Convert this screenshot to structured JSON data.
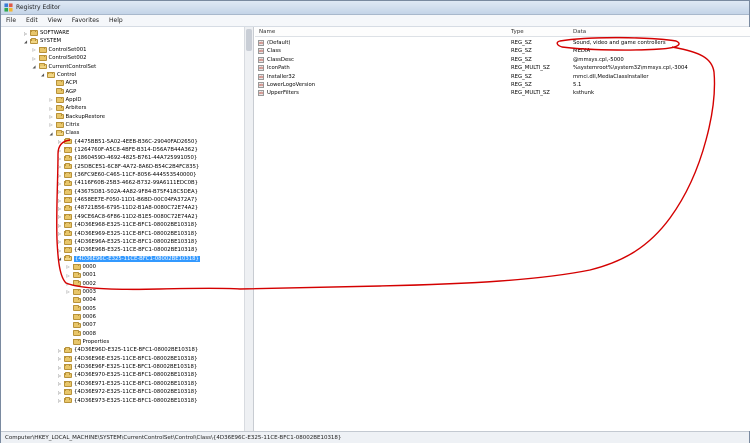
{
  "window": {
    "title": "Registry Editor",
    "icon": "registry-icon"
  },
  "menu": [
    "File",
    "Edit",
    "View",
    "Favorites",
    "Help"
  ],
  "tree": [
    {
      "label": "SOFTWARE",
      "indent": 0,
      "expander": "closed"
    },
    {
      "label": "SYSTEM",
      "indent": 0,
      "expander": "open"
    },
    {
      "label": "ControlSet001",
      "indent": 1,
      "expander": "closed"
    },
    {
      "label": "ControlSet002",
      "indent": 1,
      "expander": "closed"
    },
    {
      "label": "CurrentControlSet",
      "indent": 1,
      "expander": "open"
    },
    {
      "label": "Control",
      "indent": 2,
      "expander": "open"
    },
    {
      "label": "ACPI",
      "indent": 3,
      "expander": "none"
    },
    {
      "label": "AGP",
      "indent": 3,
      "expander": "none"
    },
    {
      "label": "AppID",
      "indent": 3,
      "expander": "closed"
    },
    {
      "label": "Arbiters",
      "indent": 3,
      "expander": "closed"
    },
    {
      "label": "BackupRestore",
      "indent": 3,
      "expander": "closed"
    },
    {
      "label": "Citrix",
      "indent": 3,
      "expander": "closed"
    },
    {
      "label": "Class",
      "indent": 3,
      "expander": "open"
    },
    {
      "label": "{4D36E968-E325-11CE-BFC1-08002BE10318}",
      "indent": 4,
      "expander": "closed"
    },
    {
      "label": "{4D36E969-E325-11CE-BFC1-08002BE10318}",
      "indent": 4,
      "expander": "closed"
    },
    {
      "label": "{4D36E96A-E325-11CE-BFC1-08002BE10318}",
      "indent": 4,
      "expander": "closed"
    },
    {
      "label": "{4D36E96B-E325-11CE-BFC1-08002BE10318}",
      "indent": 4,
      "expander": "closed"
    },
    {
      "label": "{4D36E96C-E325-11CE-BFC1-08002BE10318}",
      "indent": 4,
      "expander": "open",
      "selected": true
    },
    {
      "label": "0000",
      "indent": 5,
      "expander": "closed"
    },
    {
      "label": "0001",
      "indent": 5,
      "expander": "closed"
    },
    {
      "label": "0002",
      "indent": 5,
      "expander": "closed"
    },
    {
      "label": "0003",
      "indent": 5,
      "expander": "closed"
    },
    {
      "label": "0004",
      "indent": 5,
      "expander": "none"
    },
    {
      "label": "0005",
      "indent": 5,
      "expander": "none"
    },
    {
      "label": "0006",
      "indent": 5,
      "expander": "none"
    },
    {
      "label": "0007",
      "indent": 5,
      "expander": "none"
    },
    {
      "label": "0008",
      "indent": 5,
      "expander": "none"
    },
    {
      "label": "Properties",
      "indent": 5,
      "expander": "none"
    },
    {
      "label": "{4D36E96D-E325-11CE-BFC1-08002BE10318}",
      "indent": 4,
      "expander": "closed"
    },
    {
      "label": "{4D36E96E-E325-11CE-BFC1-08002BE10318}",
      "indent": 4,
      "expander": "closed"
    },
    {
      "label": "{4D36E96F-E325-11CE-BFC1-08002BE10318}",
      "indent": 4,
      "expander": "closed"
    },
    {
      "label": "{4D36E970-E325-11CE-BFC1-08002BE10318}",
      "indent": 4,
      "expander": "closed"
    },
    {
      "label": "{4D36E971-E325-11CE-BFC1-08002BE10318}",
      "indent": 4,
      "expander": "closed"
    },
    {
      "label": "{4D36E972-E325-11CE-BFC1-08002BE10318}",
      "indent": 4,
      "expander": "closed"
    },
    {
      "label": "{4D36E973-E325-11CE-BFC1-08002BE10318}",
      "indent": 4,
      "expander": "closed"
    }
  ],
  "tree_class_children_before": [
    "{4D36E968-E325-11CE-BFC1-08002BE10318}",
    "{4D36E969-E325-11CE-BFC1-08002BE10318}",
    "{4D36E96A-E325-11CE-BFC1-08002BE10318}",
    "{4D36E96B-E325-11CE-BFC1-08002BE10318}"
  ],
  "values": {
    "headers": {
      "name": "Name",
      "type": "Type",
      "data": "Data"
    },
    "rows": [
      {
        "name": "(Default)",
        "type": "REG_SZ",
        "data": "Sound, video and game controllers",
        "icon": "string-value-icon"
      },
      {
        "name": "Class",
        "type": "REG_SZ",
        "data": "MEDIA",
        "icon": "string-value-icon"
      },
      {
        "name": "ClassDesc",
        "type": "REG_SZ",
        "data": "@mmsys.cpl,-5000",
        "icon": "string-value-icon"
      },
      {
        "name": "IconPath",
        "type": "REG_MULTI_SZ",
        "data": "%systemroot%\\system32\\mmsys.cpl,-3004",
        "icon": "string-value-icon"
      },
      {
        "name": "Installer32",
        "type": "REG_SZ",
        "data": "mmci.dll,MediaClassInstaller",
        "icon": "string-value-icon"
      },
      {
        "name": "LowerLogoVersion",
        "type": "REG_SZ",
        "data": "5.1",
        "icon": "string-value-icon"
      },
      {
        "name": "UpperFilters",
        "type": "REG_MULTI_SZ",
        "data": "ksthunk",
        "icon": "string-value-icon"
      }
    ]
  },
  "status": "Computer\\HKEY_LOCAL_MACHINE\\SYSTEM\\CurrentControlSet\\Control\\Class\\{4D36E96C-E325-11CE-BFC1-08002BE10318}",
  "colors": {
    "annotation": "#d40000",
    "selection": "#3399ff"
  }
}
